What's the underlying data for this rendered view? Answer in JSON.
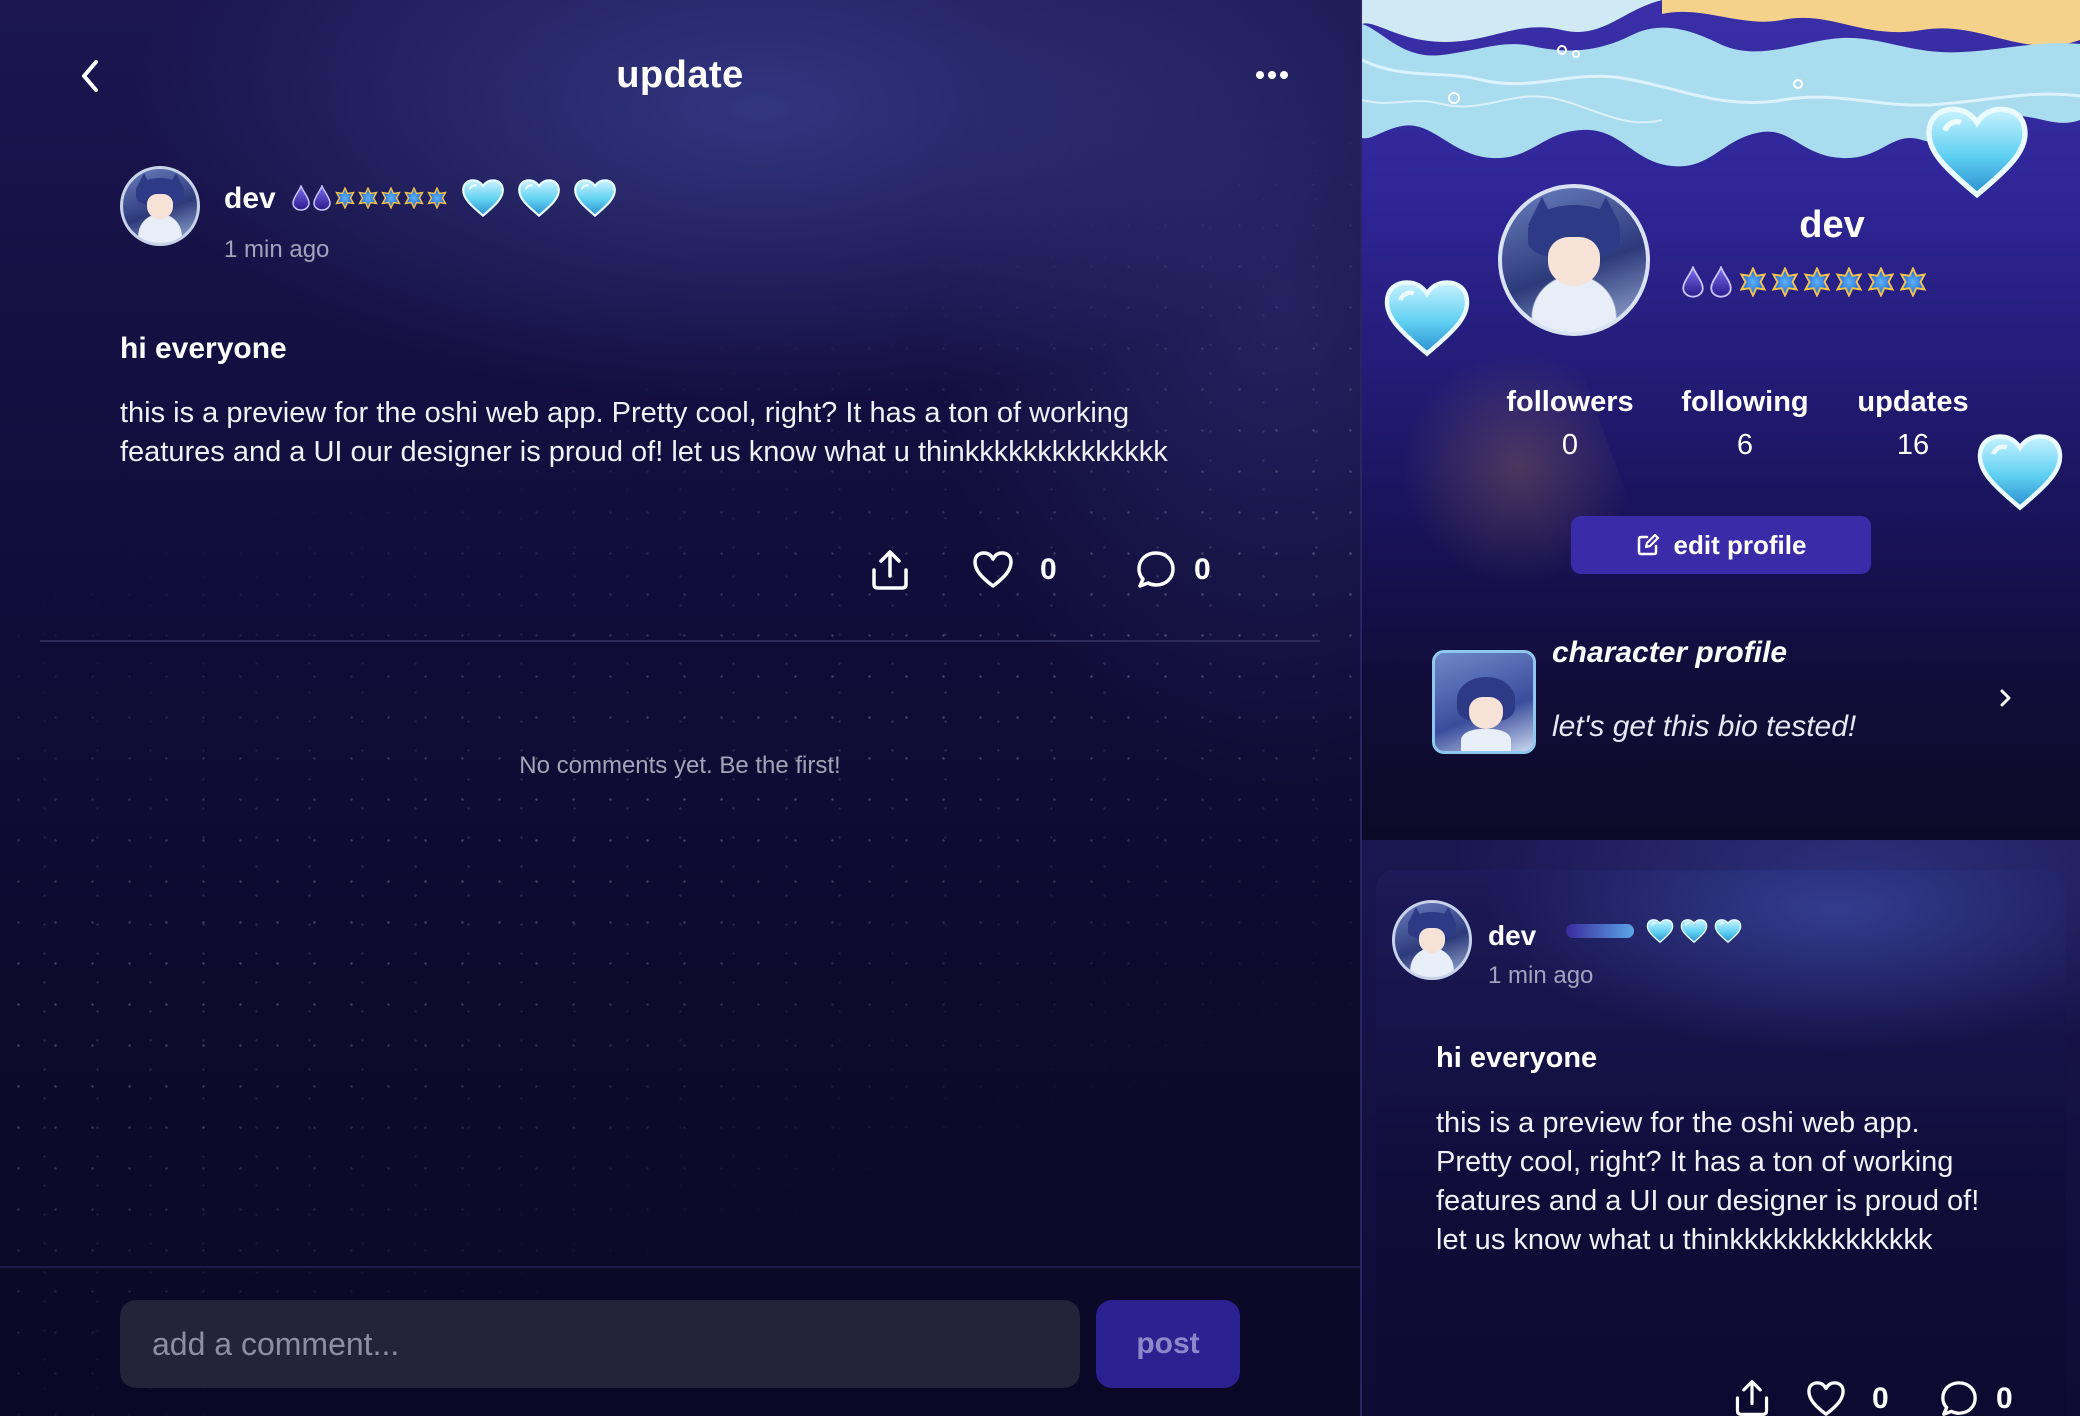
{
  "header": {
    "title": "update"
  },
  "post": {
    "author": "dev",
    "time": "1 min ago",
    "title": "hi everyone",
    "body": "this is a preview for the oshi web app. Pretty cool, right? It has a ton of working features and a UI our designer is proud of! let us know what u thinkkkkkkkkkkkkkk",
    "likes": "0",
    "comments": "0"
  },
  "comments": {
    "empty_text": "No comments yet. Be the first!"
  },
  "composer": {
    "placeholder": "add a comment...",
    "post_label": "post"
  },
  "profile": {
    "name": "dev",
    "stats": [
      {
        "label": "followers",
        "value": "0"
      },
      {
        "label": "following",
        "value": "6"
      },
      {
        "label": "updates",
        "value": "16"
      }
    ],
    "edit_label": "edit profile",
    "character": {
      "title": "character profile",
      "bio": "let's get this bio tested!"
    }
  },
  "feed_post": {
    "author": "dev",
    "time": "1 min ago",
    "title": "hi everyone",
    "body": "this is a preview for the oshi web app. Pretty cool, right? It has a ton of working features and a UI our designer is proud of! let us know what u thinkkkkkkkkkkkkkk",
    "likes": "0",
    "comments": "0"
  },
  "icons": [
    "back-arrow-icon",
    "more-icon",
    "share-icon",
    "heart-icon",
    "comment-icon",
    "edit-icon",
    "chevron-right-icon",
    "drop-badge-icon",
    "star-gem-badge-icon",
    "crystal-heart-icon"
  ],
  "colors": {
    "accent": "#3a2ca8",
    "post_button": "#2b2190",
    "badge_heart": "#5fd0f2"
  }
}
